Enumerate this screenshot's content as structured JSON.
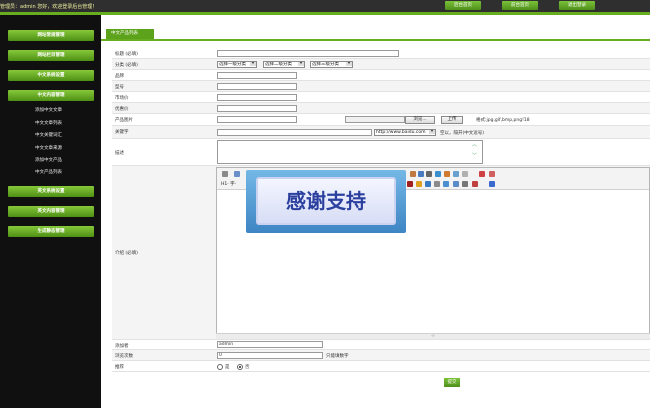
{
  "topbar": {
    "welcome": "管理员：admin 您好，欢迎登录后台管理！",
    "buttons": [
      "后台首页",
      "前台首页",
      "退出登录"
    ]
  },
  "sidebar": {
    "sections": [
      "网站常规管理",
      "网站栏目管理",
      "中文系统设置",
      "中文内容管理",
      "英文系统设置",
      "英文内容管理",
      "生成静态管理"
    ],
    "subitems": [
      "添加中文文章",
      "中文文章列表",
      "中文关键词汇",
      "中文文章来源",
      "添加中文产品",
      "中文产品列表"
    ]
  },
  "tab": {
    "label": "中文产品列表"
  },
  "form": {
    "title_label": "标题 (必填)",
    "category_label": "分类 (必填)",
    "category_selects": [
      "选择一级分类",
      "选择二级分类",
      "选择三级分类"
    ],
    "brand_label": "品牌",
    "model_label": "型号",
    "market_price_label": "市场价",
    "promo_price_label": "优惠价",
    "image_label": "产品图片",
    "browse_button": "浏览...",
    "upload_button": "上传",
    "image_format_note": "格式:jpg,gif,bmp,png!18",
    "keywords_label": "关键字",
    "keywords_select": "http://www.baidu.com",
    "keywords_note": "空以，隔开(中文逗号)",
    "description_label": "描述",
    "intro_label": "介绍 (必填)",
    "editor_toolbar_row2": "H1·  字·",
    "banner_text": "感谢支持",
    "resize_handle": "⊹",
    "adder_label": "添加者",
    "adder_value": "admin",
    "views_label": "浏览次数",
    "views_value": "0",
    "views_note": "只能填数字",
    "recommend_label": "推荐",
    "recommend_yes": "是",
    "recommend_no": "否",
    "submit_button": "提交"
  },
  "colors": {
    "accent_green": "#67ad1f",
    "sidebar_bg": "#101010",
    "topbar_bg": "#2f2f2f"
  },
  "icons": [
    "chevron-up-icon",
    "chevron-down-icon",
    "dropdown-arrow-icon",
    "editor-tool-icon"
  ]
}
